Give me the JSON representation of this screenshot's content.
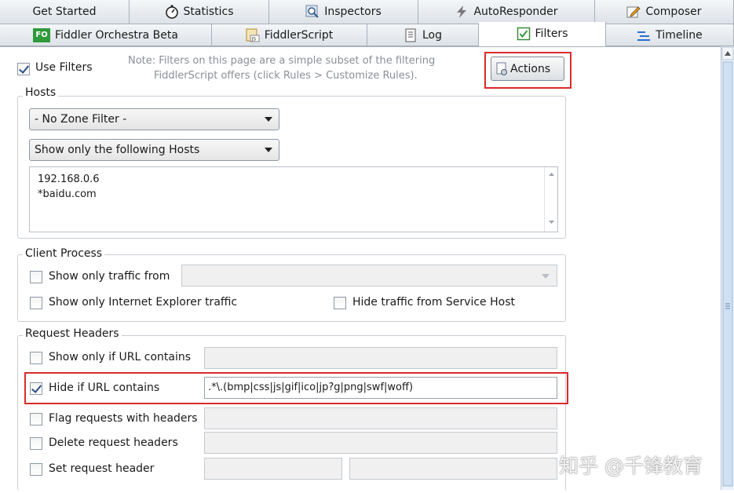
{
  "tabs_row1": [
    {
      "label": "Get Started",
      "icon": ""
    },
    {
      "label": "Statistics",
      "icon": "stopwatch-icon"
    },
    {
      "label": "Inspectors",
      "icon": "magnifier-icon"
    },
    {
      "label": "AutoResponder",
      "icon": "lightning-icon"
    },
    {
      "label": "Composer",
      "icon": "pencil-icon"
    }
  ],
  "tabs_row2": [
    {
      "label": "Fiddler Orchestra Beta",
      "icon": "fo-icon",
      "icon_text": "FO"
    },
    {
      "label": "FiddlerScript",
      "icon": "js-script-icon",
      "icon_text": "JS"
    },
    {
      "label": "Log",
      "icon": "log-icon"
    },
    {
      "label": "Filters",
      "icon": "checkbox-icon",
      "active": true
    },
    {
      "label": "Timeline",
      "icon": "timeline-icon"
    }
  ],
  "use_filters": {
    "label": "Use Filters",
    "checked": true
  },
  "note": {
    "line1": "Note: Filters on this page are a simple subset of the filtering",
    "line2": "FiddlerScript offers (click Rules > Customize Rules)."
  },
  "actions_button": "Actions",
  "hosts": {
    "title": "Hosts",
    "zone_filter": "- No Zone Filter -",
    "host_filter": "Show only the following Hosts",
    "host_list": [
      "192.168.0.6",
      "*baidu.com"
    ]
  },
  "client_process": {
    "title": "Client Process",
    "show_only_traffic_from": "Show only traffic from",
    "show_only_ie": "Show only Internet Explorer traffic",
    "hide_service_host": "Hide traffic from Service Host"
  },
  "request_headers": {
    "title": "Request Headers",
    "show_only_if_url": "Show only if URL contains",
    "hide_if_url": "Hide if URL contains",
    "hide_if_url_value": ".*\\.(bmp|css|js|gif|ico|jp?g|png|swf|woff)",
    "flag_requests": "Flag requests with headers",
    "delete_headers": "Delete request headers",
    "set_header": "Set request header"
  },
  "watermark": "知乎 @千锋教育",
  "colors": {
    "highlight": "#d92b2b",
    "tab_bg": "#dfe4ea",
    "check": "#2b4f8a"
  }
}
